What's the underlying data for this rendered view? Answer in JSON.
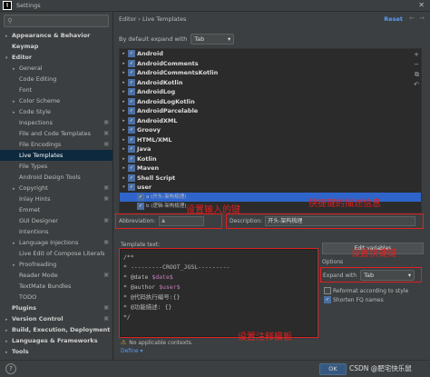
{
  "window": {
    "title": "Settings",
    "logo": "IJ"
  },
  "sidebar": {
    "items": [
      {
        "label": "Appearance & Behavior",
        "bold": true,
        "arrow": "▸"
      },
      {
        "label": "Keymap",
        "bold": true,
        "arrow": ""
      },
      {
        "label": "Editor",
        "bold": true,
        "arrow": "▾"
      },
      {
        "label": "General",
        "indent": 1,
        "arrow": "▸"
      },
      {
        "label": "Code Editing",
        "indent": 1,
        "arrow": ""
      },
      {
        "label": "Font",
        "indent": 1,
        "arrow": ""
      },
      {
        "label": "Color Scheme",
        "indent": 1,
        "arrow": "▸"
      },
      {
        "label": "Code Style",
        "indent": 1,
        "arrow": "▸"
      },
      {
        "label": "Inspections",
        "indent": 1,
        "arrow": "",
        "cfg": true
      },
      {
        "label": "File and Code Templates",
        "indent": 1,
        "arrow": "",
        "cfg": true
      },
      {
        "label": "File Encodings",
        "indent": 1,
        "arrow": "",
        "cfg": true
      },
      {
        "label": "Live Templates",
        "indent": 1,
        "arrow": "",
        "selected": true
      },
      {
        "label": "File Types",
        "indent": 1,
        "arrow": ""
      },
      {
        "label": "Android Design Tools",
        "indent": 1,
        "arrow": ""
      },
      {
        "label": "Copyright",
        "indent": 1,
        "arrow": "▸",
        "cfg": true
      },
      {
        "label": "Inlay Hints",
        "indent": 1,
        "arrow": "",
        "cfg": true
      },
      {
        "label": "Emmet",
        "indent": 1,
        "arrow": ""
      },
      {
        "label": "GUI Designer",
        "indent": 1,
        "arrow": "",
        "cfg": true
      },
      {
        "label": "Intentions",
        "indent": 1,
        "arrow": ""
      },
      {
        "label": "Language Injections",
        "indent": 1,
        "arrow": "▸",
        "cfg": true
      },
      {
        "label": "Live Edit of Compose Literals",
        "indent": 1,
        "arrow": ""
      },
      {
        "label": "Proofreading",
        "indent": 1,
        "arrow": "▸"
      },
      {
        "label": "Reader Mode",
        "indent": 1,
        "arrow": "",
        "cfg": true
      },
      {
        "label": "TextMate Bundles",
        "indent": 1,
        "arrow": ""
      },
      {
        "label": "TODO",
        "indent": 1,
        "arrow": ""
      },
      {
        "label": "Plugins",
        "bold": true,
        "arrow": "",
        "cfg": true
      },
      {
        "label": "Version Control",
        "bold": true,
        "arrow": "▸",
        "cfg": true
      },
      {
        "label": "Build, Execution, Deployment",
        "bold": true,
        "arrow": "▸"
      },
      {
        "label": "Languages & Frameworks",
        "bold": true,
        "arrow": "▸"
      },
      {
        "label": "Tools",
        "bold": true,
        "arrow": "▸"
      }
    ]
  },
  "main": {
    "breadcrumb": "Editor  ›  Live Templates",
    "reset": "Reset",
    "expand_label": "By default expand with",
    "expand_value": "Tab",
    "groups": [
      "Android",
      "AndroidComments",
      "AndroidCommentsKotlin",
      "AndroidKotlin",
      "AndroidLog",
      "AndroidLogKotlin",
      "AndroidParcelable",
      "AndroidXML",
      "Groovy",
      "HTML/XML",
      "Java",
      "Kotlin",
      "Maven",
      "Shell Script",
      "user"
    ],
    "user_templates": [
      {
        "label": "a (开头-架构梳理)",
        "selected": true
      },
      {
        "label": "b (逻辑-架构梳理)",
        "selected": false
      }
    ],
    "partial_row": "xsl",
    "abbreviation_label": "Abbreviation:",
    "abbreviation_value": "a",
    "description_label": "Description:",
    "description_value": "开头-架构梳理",
    "template_text_label": "Template text:",
    "template_lines": [
      [
        "/**",
        ""
      ],
      [
        "* ---------CROOT_JGSL---------",
        ""
      ],
      [
        "* @date ",
        "$date$"
      ],
      [
        "* @author ",
        "$user$"
      ],
      [
        "* @代码执行编号:{}",
        ""
      ],
      [
        "* @功能描述: {}",
        ""
      ],
      [
        "*/",
        ""
      ]
    ],
    "edit_variables": "Edit variables",
    "options_label": "Options",
    "expand_with_label": "Expand with",
    "expand_with_value": "Tab",
    "reformat_label": "Reformat according to style",
    "shorten_label": "Shorten FQ names",
    "no_context": "No applicable contexts.",
    "define": "Define ▾"
  },
  "annotations": {
    "abbr": "设置输入的键",
    "desc": "快捷键的描述信息",
    "expand": "设置快捷键",
    "template": "设置注释模板"
  },
  "footer": {
    "help": "?",
    "ok": "OK",
    "watermark": "CSDN @肥宅快乐鼠"
  },
  "colors": {
    "annotation": "#e02020",
    "selection": "#2f65ca",
    "link": "#589df6"
  }
}
